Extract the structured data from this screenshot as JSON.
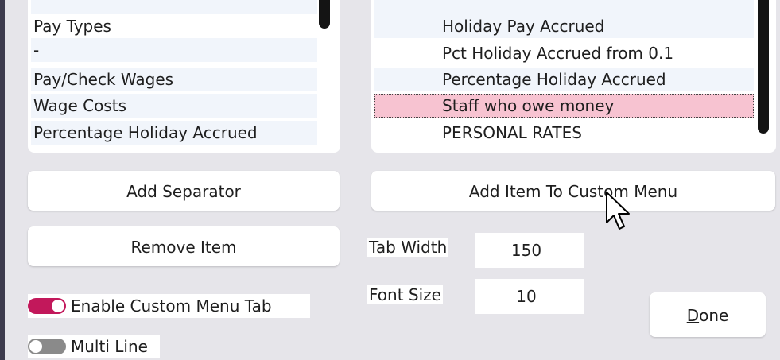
{
  "left_list": {
    "items": [
      "Pay Types",
      "-",
      "Pay/Check Wages",
      "Wage Costs",
      "Percentage Holiday Accrued"
    ]
  },
  "right_list": {
    "items": [
      "Holiday Pay Accrued",
      "Pct Holiday Accrued from 0.1",
      "Percentage Holiday Accrued",
      "Staff who owe money",
      "PERSONAL RATES"
    ],
    "selected_index": 3
  },
  "buttons": {
    "add_separator": "Add Separator",
    "remove_item": "Remove Item",
    "add_item": "Add Item To Custom Menu",
    "done_mnemonic": "D",
    "done_rest": "one"
  },
  "settings": {
    "tab_width_label": "Tab Width",
    "tab_width_value": "150",
    "font_size_label": "Font Size",
    "font_size_value": "10"
  },
  "toggles": {
    "enable_custom_menu_tab": {
      "label": "Enable Custom Menu Tab",
      "on": true
    },
    "multi_line": {
      "label": "Multi Line",
      "on": false
    }
  },
  "colors": {
    "accent": "#c2185b",
    "selection": "#f7c3d1",
    "toggle_off": "#8a8a8a",
    "background": "#e6e5ea"
  },
  "icons": {
    "cursor": "text-select-cursor"
  }
}
